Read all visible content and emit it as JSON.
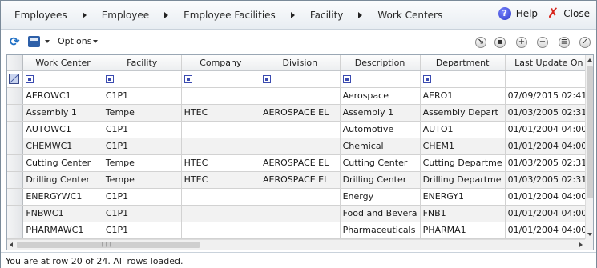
{
  "breadcrumb": [
    "Employees",
    "Employee",
    "Employee Facilities",
    "Facility",
    "Work Centers"
  ],
  "header": {
    "help_label": "Help",
    "close_label": "Close"
  },
  "toolbar": {
    "options_label": "Options"
  },
  "grid": {
    "columns": [
      "Work Center",
      "Facility",
      "Company",
      "Division",
      "Description",
      "Department",
      "Last Update On"
    ],
    "rows": [
      [
        "AEROWC1",
        "C1P1",
        "",
        "",
        "Aerospace",
        "AERO1",
        "07/09/2015 02:41:"
      ],
      [
        "Assembly 1",
        "Tempe",
        "HTEC",
        "AEROSPACE EL",
        "Assembly 1",
        "Assembly Depart",
        "01/03/2005 02:31:"
      ],
      [
        "AUTOWC1",
        "C1P1",
        "",
        "",
        "Automotive",
        "AUTO1",
        "01/01/2004 04:00:"
      ],
      [
        "CHEMWC1",
        "C1P1",
        "",
        "",
        "Chemical",
        "CHEM1",
        "01/01/2004 04:00:"
      ],
      [
        "Cutting Center",
        "Tempe",
        "HTEC",
        "AEROSPACE EL",
        "Cutting Center",
        "Cutting Departme",
        "01/03/2005 02:31:"
      ],
      [
        "Drilling Center",
        "Tempe",
        "HTEC",
        "AEROSPACE EL",
        "Drilling Center",
        "Drilling Departme",
        "01/03/2005 02:31:"
      ],
      [
        "ENERGYWC1",
        "C1P1",
        "",
        "",
        "Energy",
        "ENERGY1",
        "01/01/2004 04:00:"
      ],
      [
        "FNBWC1",
        "C1P1",
        "",
        "",
        "Food and Bevera",
        "FNB1",
        "01/01/2004 04:00:"
      ],
      [
        "PHARMAWC1",
        "C1P1",
        "",
        "",
        "Pharmaceuticals",
        "PHARMA1",
        "01/01/2004 04:00:"
      ]
    ]
  },
  "status": {
    "text": "You are at row 20 of 24. All rows loaded."
  }
}
